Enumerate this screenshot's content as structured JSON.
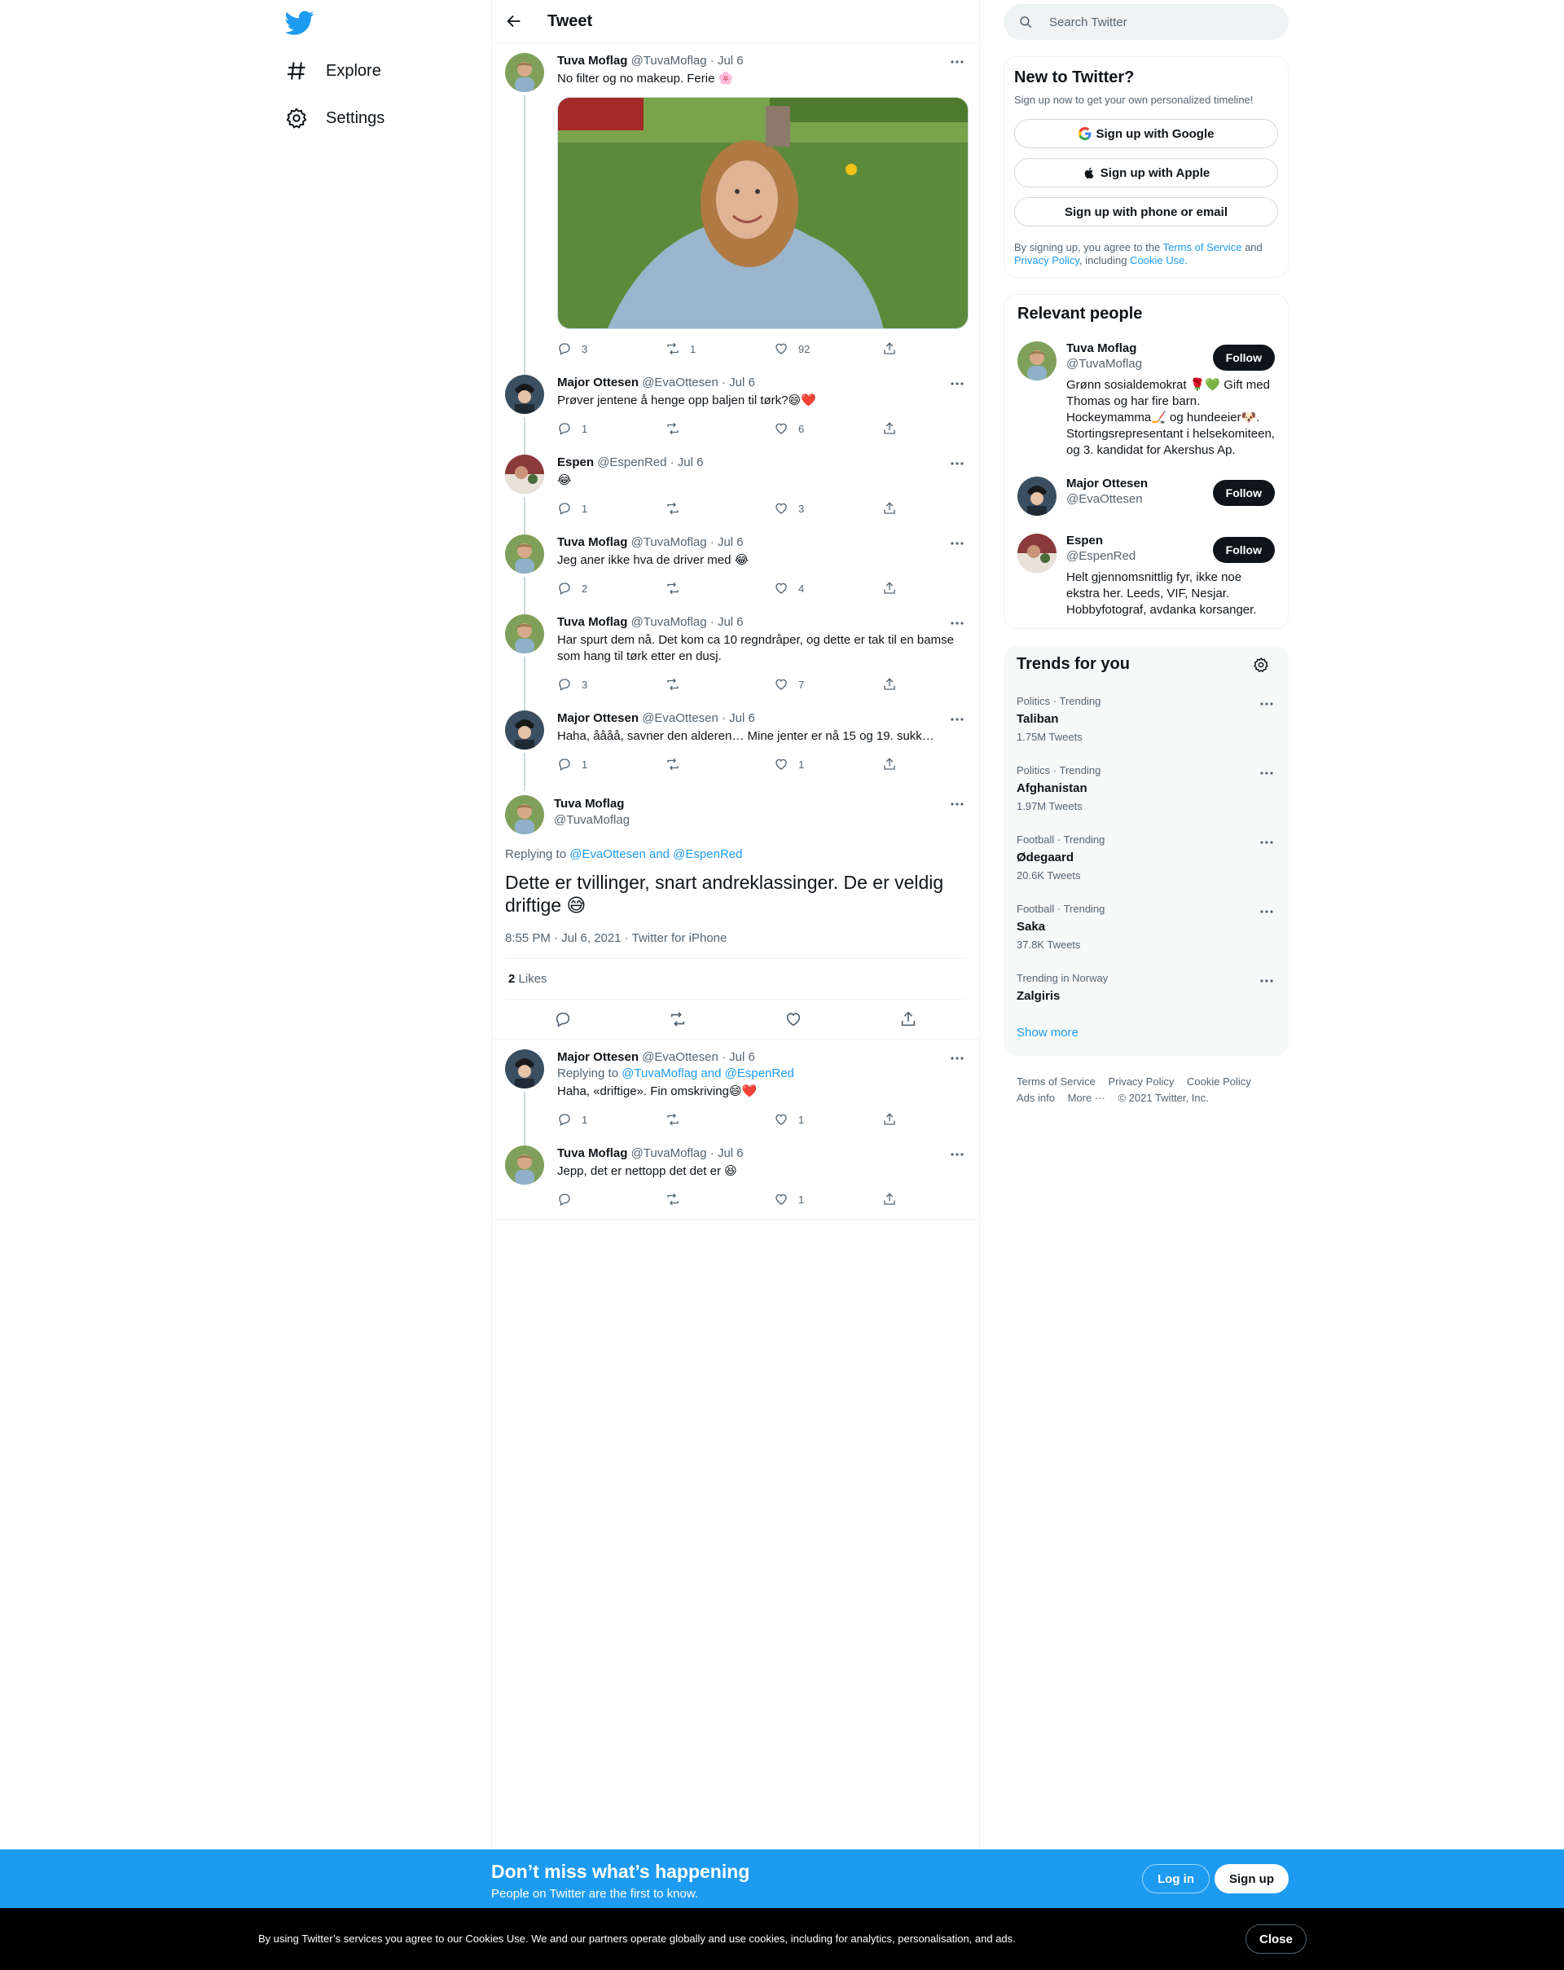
{
  "nav": {
    "explore_label": "Explore",
    "settings_label": "Settings"
  },
  "header": {
    "title": "Tweet"
  },
  "thread": [
    {
      "name": "Tuva Moflag",
      "handle": "@TuvaMoflag",
      "date": "· Jul 6",
      "text": "No filter og no makeup. Ferie 🌸",
      "has_media": true,
      "replies": "3",
      "retweets": "1",
      "likes": "92"
    },
    {
      "name": "Major Ottesen",
      "handle": "@EvaOttesen",
      "date": "· Jul 6",
      "text": "Prøver jentene å henge opp baljen til tørk?😄❤️",
      "replies": "1",
      "retweets": "",
      "likes": "6"
    },
    {
      "name": "Espen",
      "handle": "@EspenRed",
      "date": "· Jul 6",
      "text": "😂",
      "replies": "1",
      "retweets": "",
      "likes": "3"
    },
    {
      "name": "Tuva Moflag",
      "handle": "@TuvaMoflag",
      "date": "· Jul 6",
      "text": "Jeg aner ikke hva de driver med 😂",
      "replies": "2",
      "retweets": "",
      "likes": "4"
    },
    {
      "name": "Tuva Moflag",
      "handle": "@TuvaMoflag",
      "date": "· Jul 6",
      "text": "Har spurt dem nå. Det kom ca 10 regndråper, og dette er tak til en bamse som hang til tørk etter en dusj.",
      "replies": "3",
      "retweets": "",
      "likes": "7"
    },
    {
      "name": "Major Ottesen",
      "handle": "@EvaOttesen",
      "date": "· Jul 6",
      "text": "Haha, åååå, savner den alderen… Mine jenter er nå 15 og 19. sukk…",
      "replies": "1",
      "retweets": "",
      "likes": "1"
    }
  ],
  "focus": {
    "name": "Tuva Moflag",
    "handle": "@TuvaMoflag",
    "replying_prefix": "Replying to",
    "replying_to": "@EvaOttesen and @EspenRed",
    "text": "Dette er tvillinger, snart andreklassinger. De er veldig driftige 😅",
    "meta": "8:55 PM · Jul 6, 2021 · Twitter for iPhone",
    "likes_count": "2",
    "likes_label": "Likes"
  },
  "replies": [
    {
      "name": "Major Ottesen",
      "handle": "@EvaOttesen",
      "date": "· Jul 6",
      "replying_prefix": "Replying to",
      "replying_to": "@TuvaMoflag and @EspenRed",
      "text": "Haha, «driftige». Fin omskriving😄❤️",
      "replies": "1",
      "retweets": "",
      "likes": "1"
    },
    {
      "name": "Tuva Moflag",
      "handle": "@TuvaMoflag",
      "date": "· Jul 6",
      "text": "Jepp, det er nettopp det det er 😆",
      "replies": "",
      "retweets": "",
      "likes": "1"
    }
  ],
  "search": {
    "placeholder": "Search Twitter"
  },
  "new_to_twitter": {
    "title": "New to Twitter?",
    "subtitle": "Sign up now to get your own personalized timeline!",
    "google": "Sign up with Google",
    "apple": "Sign up with Apple",
    "phone": "Sign up with phone or email",
    "terms_1": "By signing up, you agree to the",
    "terms_link_1": "Terms of Service",
    "terms_2": "and",
    "terms_link_2": "Privacy Policy",
    "terms_3": ", including",
    "terms_link_3": "Cookie Use."
  },
  "relevant_people": {
    "title": "Relevant people",
    "follow_label": "Follow",
    "people": [
      {
        "name": "Tuva Moflag",
        "handle": "@TuvaMoflag",
        "bio": "Grønn sosialdemokrat 🌹💚 Gift med Thomas og har fire barn. Hockeymamma🏒 og hundeeier🐶. Stortingsrepresentant i helsekomiteen, og 3. kandidat for Akershus Ap."
      },
      {
        "name": "Major Ottesen",
        "handle": "@EvaOttesen",
        "bio": ""
      },
      {
        "name": "Espen",
        "handle": "@EspenRed",
        "bio": "Helt gjennomsnittlig fyr, ikke noe ekstra her. Leeds, VIF, Nesjar. Hobbyfotograf, avdanka korsanger."
      }
    ]
  },
  "trends": {
    "title": "Trends for you",
    "items": [
      {
        "meta": "Politics · Trending",
        "name": "Taliban",
        "count": "1.75M Tweets"
      },
      {
        "meta": "Politics · Trending",
        "name": "Afghanistan",
        "count": "1.97M Tweets"
      },
      {
        "meta": "Football · Trending",
        "name": "Ødegaard",
        "count": "20.6K Tweets"
      },
      {
        "meta": "Football · Trending",
        "name": "Saka",
        "count": "37.8K Tweets"
      },
      {
        "meta": "Trending in Norway",
        "name": "Zalgiris",
        "count": ""
      }
    ],
    "show_more": "Show more"
  },
  "footer": {
    "terms": "Terms of Service",
    "privacy": "Privacy Policy",
    "cookie": "Cookie Policy",
    "ads": "Ads info",
    "more": "More ···",
    "copyright": "© 2021 Twitter, Inc."
  },
  "signup_bar": {
    "title": "Don’t miss what’s happening",
    "subtitle": "People on Twitter are the first to know.",
    "login": "Log in",
    "signup": "Sign up"
  },
  "cookie_bar": {
    "message": "By using Twitter’s services you agree to our Cookies Use. We and our partners operate globally and use cookies, including for analytics, personalisation, and ads.",
    "close": "Close"
  },
  "colors": {
    "accent": "#1d9bf0",
    "text": "#0f1419",
    "muted": "#536471",
    "border": "#eff3f4"
  },
  "icons": [
    "twitter-logo-icon",
    "hashtag-icon",
    "gear-icon",
    "back-arrow-icon",
    "more-icon",
    "reply-icon",
    "retweet-icon",
    "like-icon",
    "share-icon",
    "search-icon",
    "google-icon",
    "apple-icon"
  ]
}
